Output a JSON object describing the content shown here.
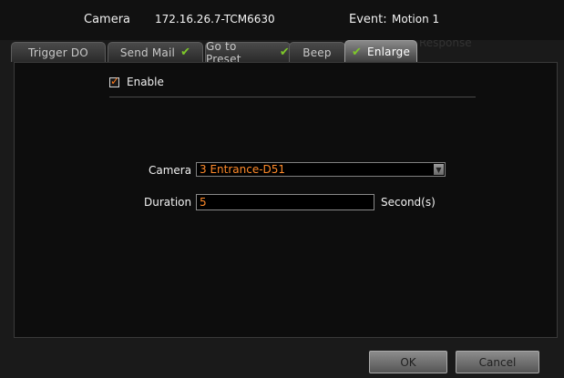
{
  "header": {
    "camera_label": "Camera",
    "camera_value": "172.16.26.7-TCM6630",
    "event_label": "Event:",
    "event_value": "Motion 1"
  },
  "tabs": [
    {
      "label": "Trigger DO",
      "checked": false,
      "active": false
    },
    {
      "label": "Send Mail",
      "checked": true,
      "active": false
    },
    {
      "label": "Go to Preset",
      "checked": true,
      "active": false
    },
    {
      "label": "Beep",
      "checked": true,
      "active": false
    },
    {
      "label": "Enlarge",
      "checked": true,
      "active": true
    }
  ],
  "form": {
    "enable_label": "Enable",
    "enable_checked": true,
    "camera_label": "Camera",
    "camera_value": "3 Entrance-D51",
    "duration_label": "Duration",
    "duration_value": "5",
    "duration_unit": "Second(s)"
  },
  "footer": {
    "ok_label": "OK",
    "cancel_label": "Cancel"
  },
  "colors": {
    "accent_value": "#ff8a2a",
    "check_green": "#7ec82a"
  }
}
